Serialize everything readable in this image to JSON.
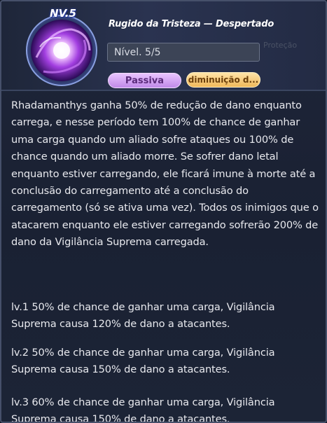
{
  "header": {
    "level_badge": "NV.5",
    "skill_name": "Rugido da Tristeza — Despertado",
    "level_text": "Nível. 5/5",
    "background_label": "Proteção",
    "tag_type": "Passiva",
    "tag_effect": "diminuição d..."
  },
  "description": "Rhadamanthys ganha 50% de redução de dano enquanto carrega, e nesse período tem 100% de chance de ganhar uma carga quando um aliado sofre ataques ou 100% de chance quando um aliado morre. Se sofrer dano letal enquanto estiver carregando, ele ficará imune à morte até a conclusão do carregamento até a conclusão do carregamento (só se ativa uma vez). Todos os inimigos que o atacarem enquanto ele estiver carregando sofrerão 200% de dano da Vigilância Suprema carregada.",
  "levels": [
    {
      "text": "lv.1 50% de chance de ganhar uma carga, Vigilância Suprema causa 120% de dano a atacantes."
    },
    {
      "text": "lv.2 50% de chance de ganhar uma carga, Vigilância Suprema causa 150% de dano a atacantes."
    },
    {
      "text": "lv.3 60% de chance de ganhar uma carga, Vigilância Suprema causa 150% de dano a atacantes."
    }
  ],
  "colors": {
    "panel_bg": "#1a2133",
    "text": "#e8e9ee",
    "passive_tag": "#c08ae8",
    "effect_tag": "#f0b85a"
  },
  "icons": {
    "skill_emblem": "purple-vortex-skill-icon"
  }
}
